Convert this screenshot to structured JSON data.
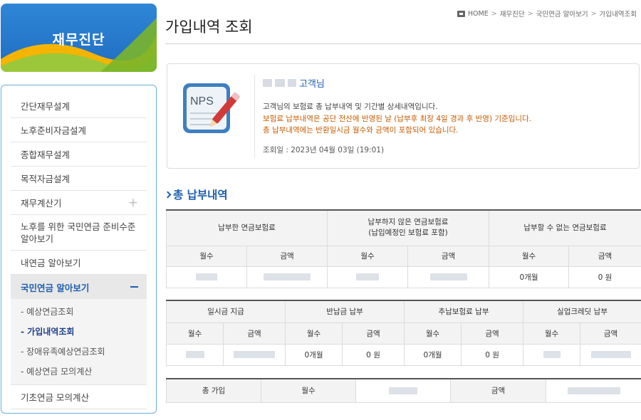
{
  "sidebar": {
    "banner_title": "재무진단",
    "items": [
      {
        "label": "간단재무설계"
      },
      {
        "label": "노후준비자금설계"
      },
      {
        "label": "종합재무설계"
      },
      {
        "label": "목적자금설계"
      },
      {
        "label": "재무계산기",
        "expand_icon": "plus"
      },
      {
        "label": "노후를 위한 국민연금 준비수준 알아보기"
      },
      {
        "label": "내연금 알아보기"
      },
      {
        "label": "국민연금 알아보기",
        "expand_icon": "minus",
        "active": true
      },
      {
        "label": "기초연금 모의계산"
      }
    ],
    "submenu": [
      {
        "label": "- 예상연금조회"
      },
      {
        "label": "- 가입내역조회",
        "current": true
      },
      {
        "label": "- 장애유족예상연금조회"
      },
      {
        "label": "- 예상연금 모의계산"
      }
    ]
  },
  "breadcrumb": [
    "HOME",
    "재무진단",
    "국민연금 알아보기",
    "가입내역조회"
  ],
  "breadcrumb_sep": ">",
  "page_title": "가입내역 조회",
  "card": {
    "icon": "nps-document-icon",
    "icon_text": "NPS",
    "customer_suffix": "고객님",
    "line1": "고객님의 보험료 총 납부내역 및 기간별 상세내역입니다.",
    "line2": "보험료 납부내역은 공단 전산에 반영된 날 (납부후 최장 4일 경과 후 반영) 기준입니다.",
    "line3": "총 납부내역에는 반환일시금 월수와 금액이 포함되어 있습니다.",
    "lookup_date": "조회일 : 2023년 04월 03일 (19:01)"
  },
  "section_title": "총 납부내역",
  "table1": {
    "groups": [
      "납부한 연금보험료",
      "납부하지 않은 연금보험료",
      "납부할 수 없는 연금보험료"
    ],
    "group2_sub": "(납입예정인 보험료 포함)",
    "sub_headers": [
      "월수",
      "금액",
      "월수",
      "금액",
      "월수",
      "금액"
    ],
    "values": [
      "",
      "",
      "",
      "",
      "0개월",
      "0 원"
    ]
  },
  "table2": {
    "groups": [
      "일시금 지급",
      "반납금 납부",
      "추납보험료 납부",
      "실업크레딧 납부"
    ],
    "sub_headers": [
      "월수",
      "금액",
      "월수",
      "금액",
      "월수",
      "금액",
      "월수",
      "금액"
    ],
    "values": [
      "",
      "",
      "0개월",
      "0 원",
      "0개월",
      "0 원",
      "",
      ""
    ]
  },
  "table3": {
    "label": "총 가입",
    "months_label": "월수",
    "amount_label": "금액"
  },
  "colors": {
    "accent": "#1f5fb0",
    "notice": "#c85a00",
    "sidebar_border": "#6aaee0"
  }
}
